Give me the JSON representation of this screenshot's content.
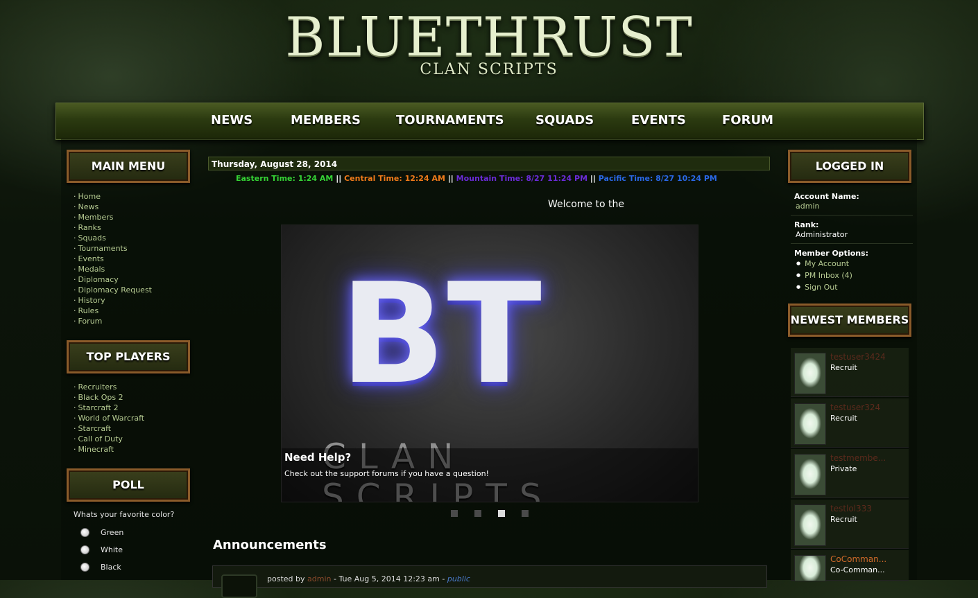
{
  "site": {
    "title": "BLUETHRUST",
    "subtitle": "CLAN SCRIPTS"
  },
  "nav": [
    "NEWS",
    "MEMBERS",
    "TOURNAMENTS",
    "SQUADS",
    "EVENTS",
    "FORUM"
  ],
  "main_menu": {
    "header": "MAIN MENU",
    "items": [
      "Home",
      "News",
      "Members",
      "Ranks",
      "Squads",
      "Tournaments",
      "Events",
      "Medals",
      "Diplomacy",
      "Diplomacy Request",
      "History",
      "Rules",
      "Forum"
    ]
  },
  "top_players": {
    "header": "TOP PLAYERS",
    "items": [
      "Recruiters",
      "Black Ops 2",
      "Starcraft 2",
      "World of Warcraft",
      "Starcraft",
      "Call of Duty",
      "Minecraft"
    ]
  },
  "poll": {
    "header": "POLL",
    "question": "Whats your favorite color?",
    "options": [
      "Green",
      "White",
      "Black"
    ]
  },
  "date_bar": "Thursday, August 28, 2014",
  "times": [
    {
      "text": "Eastern Time: 1:24 AM",
      "color": "#35d335"
    },
    {
      "text": "Central Time: 12:24 AM",
      "color": "#ef7a1a"
    },
    {
      "text": "Mountain Time: 8/27 11:24 PM",
      "color": "#6b2bd8"
    },
    {
      "text": "Pacific Time: 8/27 10:24 PM",
      "color": "#2a68e6"
    }
  ],
  "separator": "||",
  "welcome": "Welcome to the",
  "slider": {
    "logo_text": "BT",
    "logo_subtext": "CLAN SCRIPTS",
    "caption_title": "Need Help?",
    "caption_text": "Check out the support forums if you have a question!",
    "slide_count": 4,
    "active_slide": 3
  },
  "announcements": {
    "title": "Announcements",
    "post": {
      "prefix": "posted by",
      "author": "admin",
      "dash1": "-",
      "date": "Tue Aug 5, 2014 12:23 am",
      "dash2": "-",
      "visibility": "public"
    }
  },
  "logged_in": {
    "header": "LOGGED IN",
    "account_label": "Account Name:",
    "account_value": "admin",
    "rank_label": "Rank:",
    "rank_value": "Administrator",
    "options_label": "Member Options:",
    "options": [
      "My Account",
      "PM Inbox (4)",
      "Sign Out"
    ]
  },
  "newest_members": {
    "header": "NEWEST MEMBERS",
    "members": [
      {
        "name": "testuser3424",
        "rank": "Recruit",
        "color": "#5c2a1c"
      },
      {
        "name": "testuser324",
        "rank": "Recruit",
        "color": "#5c2a1c"
      },
      {
        "name": "testmembe...",
        "rank": "Private",
        "color": "#5c2a1c"
      },
      {
        "name": "testlol333",
        "rank": "Recruit",
        "color": "#5c2a1c"
      },
      {
        "name": "CoComman...",
        "rank": "Co-Comman...",
        "color": "#d06a2a"
      }
    ]
  },
  "colors": {
    "link": "#b7cc93",
    "accent_green": "#2b3a10",
    "header_border": "#8a5b2a"
  }
}
